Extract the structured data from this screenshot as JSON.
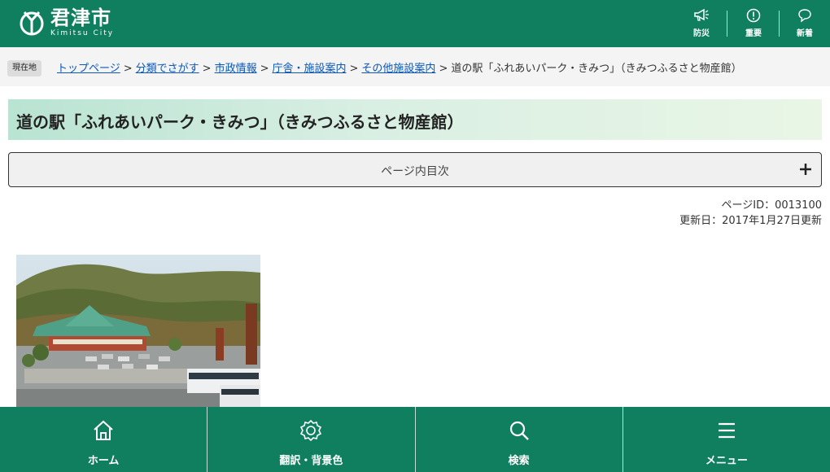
{
  "header": {
    "logo_text": "君津市",
    "logo_sub": "Kimitsu City",
    "buttons": [
      {
        "label": "防災",
        "icon": "megaphone-icon"
      },
      {
        "label": "重要",
        "icon": "alert-circle-icon"
      },
      {
        "label": "新着",
        "icon": "speech-bubble-icon"
      }
    ],
    "bg_color": "#0f7f5f"
  },
  "breadcrumb": {
    "badge": "現在地",
    "items": [
      "トップページ",
      "分類でさがす",
      "市政情報",
      "庁舎・施設案内",
      "その他施設案内"
    ],
    "separator": ">",
    "current": "道の駅「ふれあいパーク・きみつ」（きみつふるさと物産館）"
  },
  "page": {
    "title": "道の駅「ふれあいパーク・きみつ」（きみつふるさと物産館）",
    "toc_label": "ページ内目次",
    "page_id": "ページID：0013100",
    "updated": "更新日：2017年1月27日更新"
  },
  "bottom_nav": [
    {
      "label": "ホーム",
      "icon": "home-icon"
    },
    {
      "label": "翻訳・背景色",
      "icon": "gear-icon"
    },
    {
      "label": "検索",
      "icon": "search-icon"
    },
    {
      "label": "メニュー",
      "icon": "menu-icon"
    }
  ]
}
